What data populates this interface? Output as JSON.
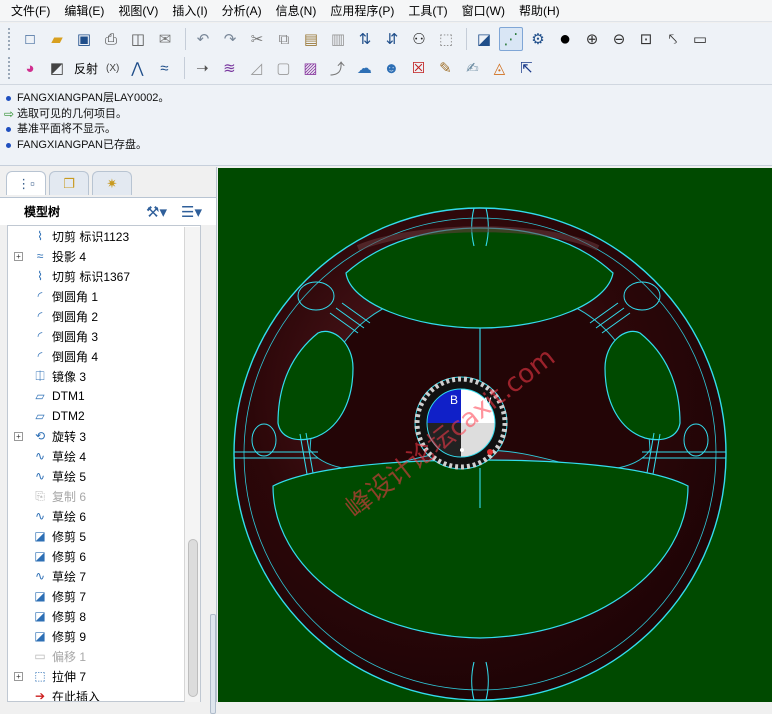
{
  "menubar": [
    "文件(F)",
    "编辑(E)",
    "视图(V)",
    "插入(I)",
    "分析(A)",
    "信息(N)",
    "应用程序(P)",
    "工具(T)",
    "窗口(W)",
    "帮助(H)"
  ],
  "toolbar2": {
    "label_fanshe": "反射",
    "label_x": "(X)"
  },
  "messages": [
    {
      "type": "info",
      "text": "FANGXIANGPAN层LAY0002。"
    },
    {
      "type": "prompt",
      "text": "选取可见的几何项目。"
    },
    {
      "type": "info",
      "text": "基准平面将不显示。"
    },
    {
      "type": "info",
      "text": "FANGXIANGPAN已存盘。"
    }
  ],
  "model_tree": {
    "title": "模型树",
    "items": [
      {
        "label": "切剪 标识1123",
        "icon": "cut-icon",
        "expandable": false,
        "dim": false
      },
      {
        "label": "投影 4",
        "icon": "projection-icon",
        "expandable": true,
        "dim": false
      },
      {
        "label": "切剪 标识1367",
        "icon": "cut-icon",
        "expandable": false,
        "dim": false
      },
      {
        "label": "倒圆角 1",
        "icon": "round-icon",
        "expandable": false,
        "dim": false
      },
      {
        "label": "倒圆角 2",
        "icon": "round-icon",
        "expandable": false,
        "dim": false
      },
      {
        "label": "倒圆角 3",
        "icon": "round-icon",
        "expandable": false,
        "dim": false
      },
      {
        "label": "倒圆角 4",
        "icon": "round-icon",
        "expandable": false,
        "dim": false
      },
      {
        "label": "镜像 3",
        "icon": "mirror-icon",
        "expandable": false,
        "dim": false
      },
      {
        "label": "DTM1",
        "icon": "datum-plane-icon",
        "expandable": false,
        "dim": false
      },
      {
        "label": "DTM2",
        "icon": "datum-plane-icon",
        "expandable": false,
        "dim": false
      },
      {
        "label": "旋转 3",
        "icon": "revolve-icon",
        "expandable": true,
        "dim": false
      },
      {
        "label": "草绘 4",
        "icon": "sketch-icon",
        "expandable": false,
        "dim": false
      },
      {
        "label": "草绘 5",
        "icon": "sketch-icon",
        "expandable": false,
        "dim": false
      },
      {
        "label": "复制 6",
        "icon": "copy-icon",
        "expandable": false,
        "dim": true
      },
      {
        "label": "草绘 6",
        "icon": "sketch-icon",
        "expandable": false,
        "dim": false
      },
      {
        "label": "修剪 5",
        "icon": "trim-icon",
        "expandable": false,
        "dim": false
      },
      {
        "label": "修剪 6",
        "icon": "trim-icon",
        "expandable": false,
        "dim": false
      },
      {
        "label": "草绘 7",
        "icon": "sketch-icon",
        "expandable": false,
        "dim": false
      },
      {
        "label": "修剪 7",
        "icon": "trim-icon",
        "expandable": false,
        "dim": false
      },
      {
        "label": "修剪 8",
        "icon": "trim-icon",
        "expandable": false,
        "dim": false
      },
      {
        "label": "修剪 9",
        "icon": "trim-icon",
        "expandable": false,
        "dim": false
      },
      {
        "label": "偏移 1",
        "icon": "offset-icon",
        "expandable": false,
        "dim": true
      },
      {
        "label": "拉伸 7",
        "icon": "extrude-icon",
        "expandable": true,
        "dim": false
      },
      {
        "label": "在此插入",
        "icon": "insert-here-icon",
        "expandable": false,
        "dim": false,
        "insert": true
      }
    ]
  },
  "viewport": {
    "background_color": "#004a00",
    "wheel_color": "#2a0608",
    "edge_color": "#33ddee",
    "watermark": "峰设计论坛caxit.com",
    "logo_letters": [
      "B",
      "M",
      "W"
    ]
  },
  "colors": {
    "accent": "#1f4fbf",
    "prompt_arrow": "#2f8f2f",
    "insert_marker": "#cc1f1f"
  }
}
